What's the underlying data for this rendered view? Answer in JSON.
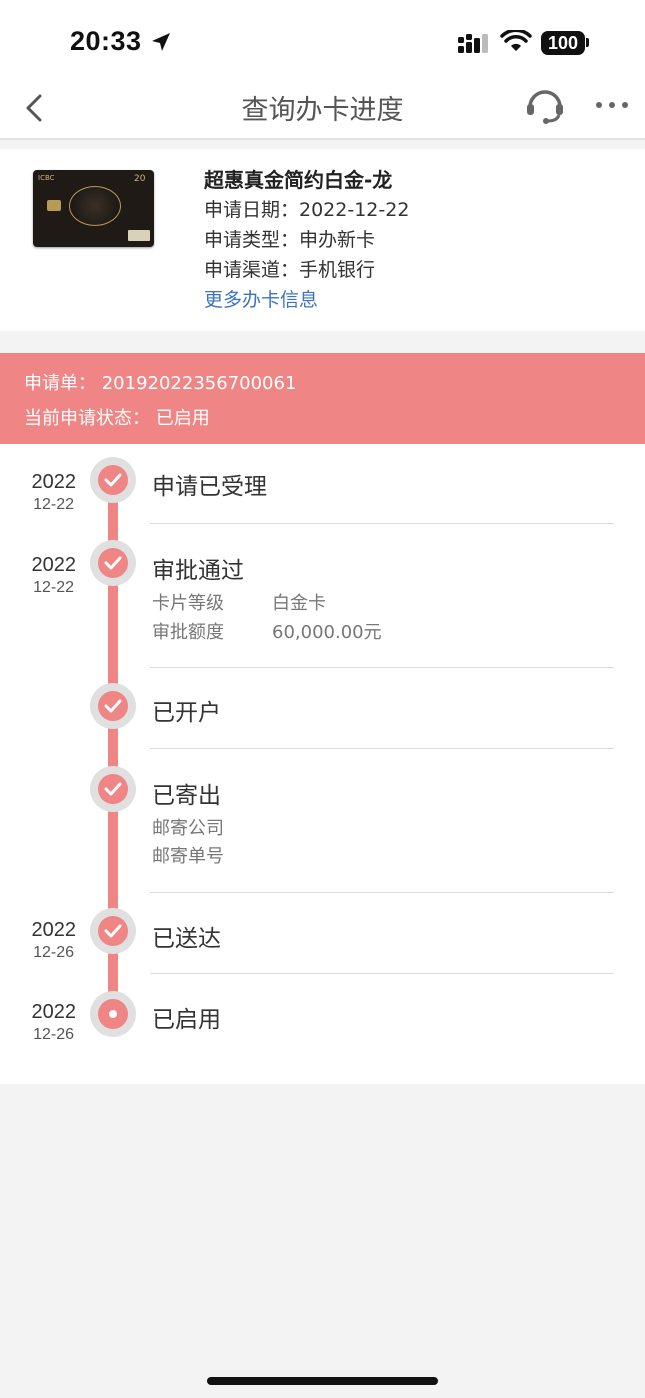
{
  "status_bar": {
    "time": "20:33",
    "battery": "100"
  },
  "nav": {
    "title": "查询办卡进度"
  },
  "card": {
    "brand": "ICBC",
    "number_mark": "20",
    "name": "超惠真金简约白金-龙",
    "apply_date": "申请日期：2022-12-22",
    "apply_type": "申请类型：申办新卡",
    "apply_channel": "申请渠道：手机银行",
    "more_link": "更多办卡信息"
  },
  "banner": {
    "application": "申请单： 20192022356700061",
    "status": "当前申请状态： 已启用"
  },
  "timeline": [
    {
      "year": "2022",
      "md": "12-22",
      "title": "申请已受理"
    },
    {
      "year": "2022",
      "md": "12-22",
      "title": "审批通过",
      "details": [
        {
          "label": "卡片等级",
          "value": "白金卡"
        },
        {
          "label": "审批额度",
          "value": "60,000.00元"
        }
      ]
    },
    {
      "year": "",
      "md": "",
      "title": "已开户"
    },
    {
      "year": "",
      "md": "",
      "title": "已寄出",
      "details": [
        {
          "label": "邮寄公司",
          "value": ""
        },
        {
          "label": "邮寄单号",
          "value": ""
        }
      ]
    },
    {
      "year": "2022",
      "md": "12-26",
      "title": "已送达"
    },
    {
      "year": "2022",
      "md": "12-26",
      "title": "已启用",
      "current": true
    }
  ],
  "colors": {
    "accent": "#ef8584",
    "link": "#3b73c2"
  },
  "icons": [
    "location-arrow-icon",
    "signal-icon",
    "wifi-icon",
    "back-icon",
    "customer-service-icon",
    "more-icon",
    "check-icon"
  ]
}
